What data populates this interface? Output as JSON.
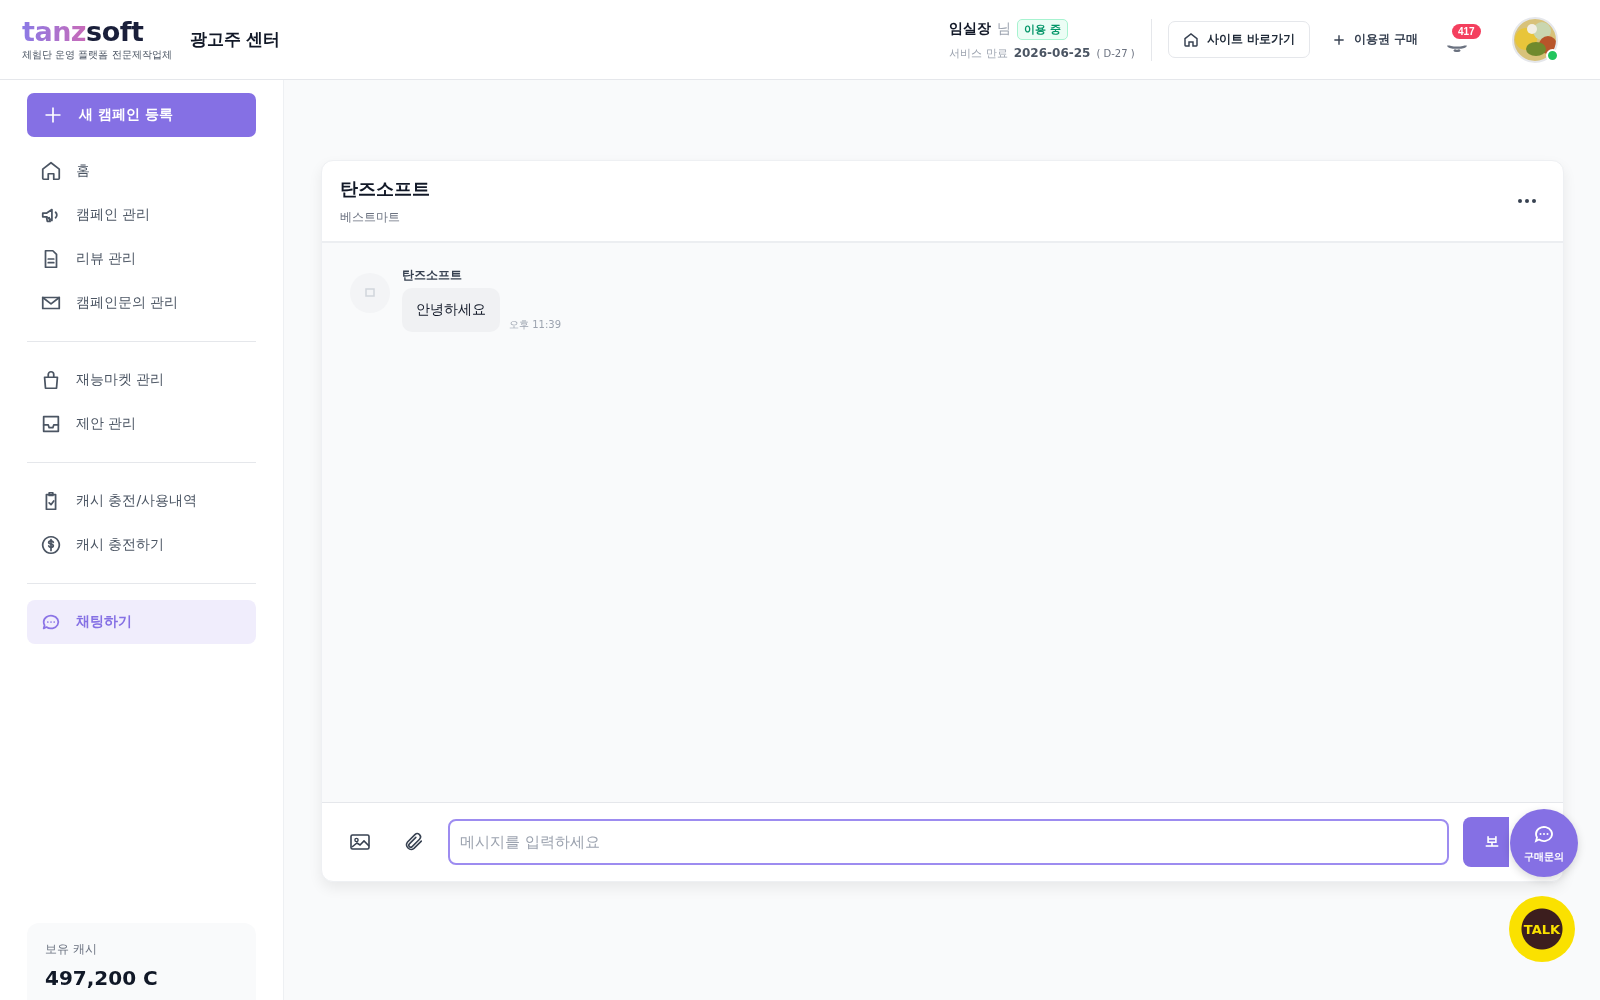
{
  "logo": {
    "brand_a": "tanz",
    "brand_b": "soft",
    "tagline": "체험단 운영 플랫폼 전문제작업체",
    "center": "광고주 센터"
  },
  "header": {
    "user": "임실장",
    "suffix": "님",
    "status_badge": "이용 중",
    "expiry_label": "서비스 만료",
    "expiry_date": "2026-06-25",
    "d_day": "( D-27 )",
    "site_button": "사이트 바로가기",
    "buy_button": "이용권 구매",
    "notification_count": "417"
  },
  "sidebar": {
    "new_button": "새 캠페인 등록",
    "groups": [
      [
        {
          "label": "홈",
          "selected": false
        },
        {
          "label": "캠페인 관리",
          "selected": false
        },
        {
          "label": "리뷰 관리",
          "selected": false
        },
        {
          "label": "캠페인문의 관리",
          "selected": false
        }
      ],
      [
        {
          "label": "재능마켓 관리",
          "selected": false
        },
        {
          "label": "제안 관리",
          "selected": false
        }
      ],
      [
        {
          "label": "캐시 충전/사용내역",
          "selected": false
        },
        {
          "label": "캐시 충전하기",
          "selected": false
        }
      ],
      [
        {
          "label": "채팅하기",
          "selected": true
        }
      ]
    ],
    "cash_label": "보유 캐시",
    "cash_value": "497,200 C"
  },
  "chat": {
    "title": "탄즈소프트",
    "subtitle": "베스트마트",
    "messages": [
      {
        "sender": "탄즈소프트",
        "text": "안녕하세요",
        "time": "오후 11:39"
      }
    ],
    "input": {
      "placeholder": "메시지를 입력하세요"
    },
    "send_button": "보"
  },
  "floating": {
    "inquiry": "구매문의",
    "talk": "TALK"
  }
}
